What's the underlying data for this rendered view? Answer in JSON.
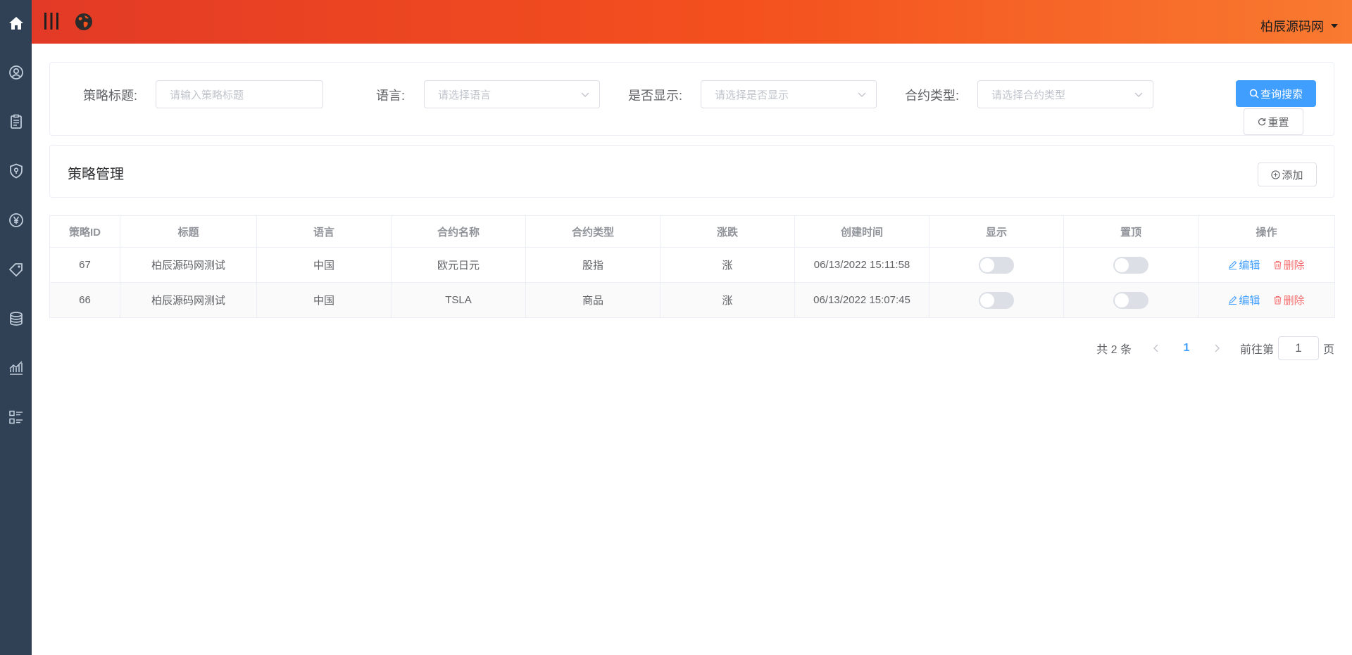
{
  "header": {
    "user_name": "柏辰源码网"
  },
  "search": {
    "title_label": "策略标题:",
    "title_placeholder": "请输入策略标题",
    "language_label": "语言:",
    "language_placeholder": "请选择语言",
    "display_label": "是否显示:",
    "display_placeholder": "请选择是否显示",
    "contract_type_label": "合约类型:",
    "contract_type_placeholder": "请选择合约类型",
    "search_button": "查询搜索",
    "reset_button": "重置"
  },
  "panel": {
    "title": "策略管理",
    "add_button": "添加"
  },
  "table": {
    "columns": [
      "策略ID",
      "标题",
      "语言",
      "合约名称",
      "合约类型",
      "涨跌",
      "创建时间",
      "显示",
      "置顶",
      "操作"
    ],
    "rows": [
      {
        "id": "67",
        "title": "柏辰源码网测试",
        "language": "中国",
        "contract_name": "欧元日元",
        "contract_type": "股指",
        "change": "涨",
        "created": "06/13/2022 15:11:58",
        "display_on": false,
        "top_on": false
      },
      {
        "id": "66",
        "title": "柏辰源码网测试",
        "language": "中国",
        "contract_name": "TSLA",
        "contract_type": "商品",
        "change": "涨",
        "created": "06/13/2022 15:07:45",
        "display_on": false,
        "top_on": false
      }
    ],
    "edit_label": "编辑",
    "delete_label": "删除"
  },
  "pagination": {
    "total_text": "共 2 条",
    "current_page": "1",
    "goto_prefix": "前往第",
    "goto_value": "1",
    "goto_suffix": "页"
  },
  "colors": {
    "sidebar": "#304156",
    "header_start": "#e23a26",
    "header_end": "#f97a30",
    "primary": "#409eff",
    "danger": "#f56c6c"
  },
  "sidebar_icons": [
    "home-icon",
    "user-icon",
    "clipboard-icon",
    "shield-icon",
    "yen-icon",
    "tag-icon",
    "coins-icon",
    "chart-icon",
    "list-icon"
  ]
}
